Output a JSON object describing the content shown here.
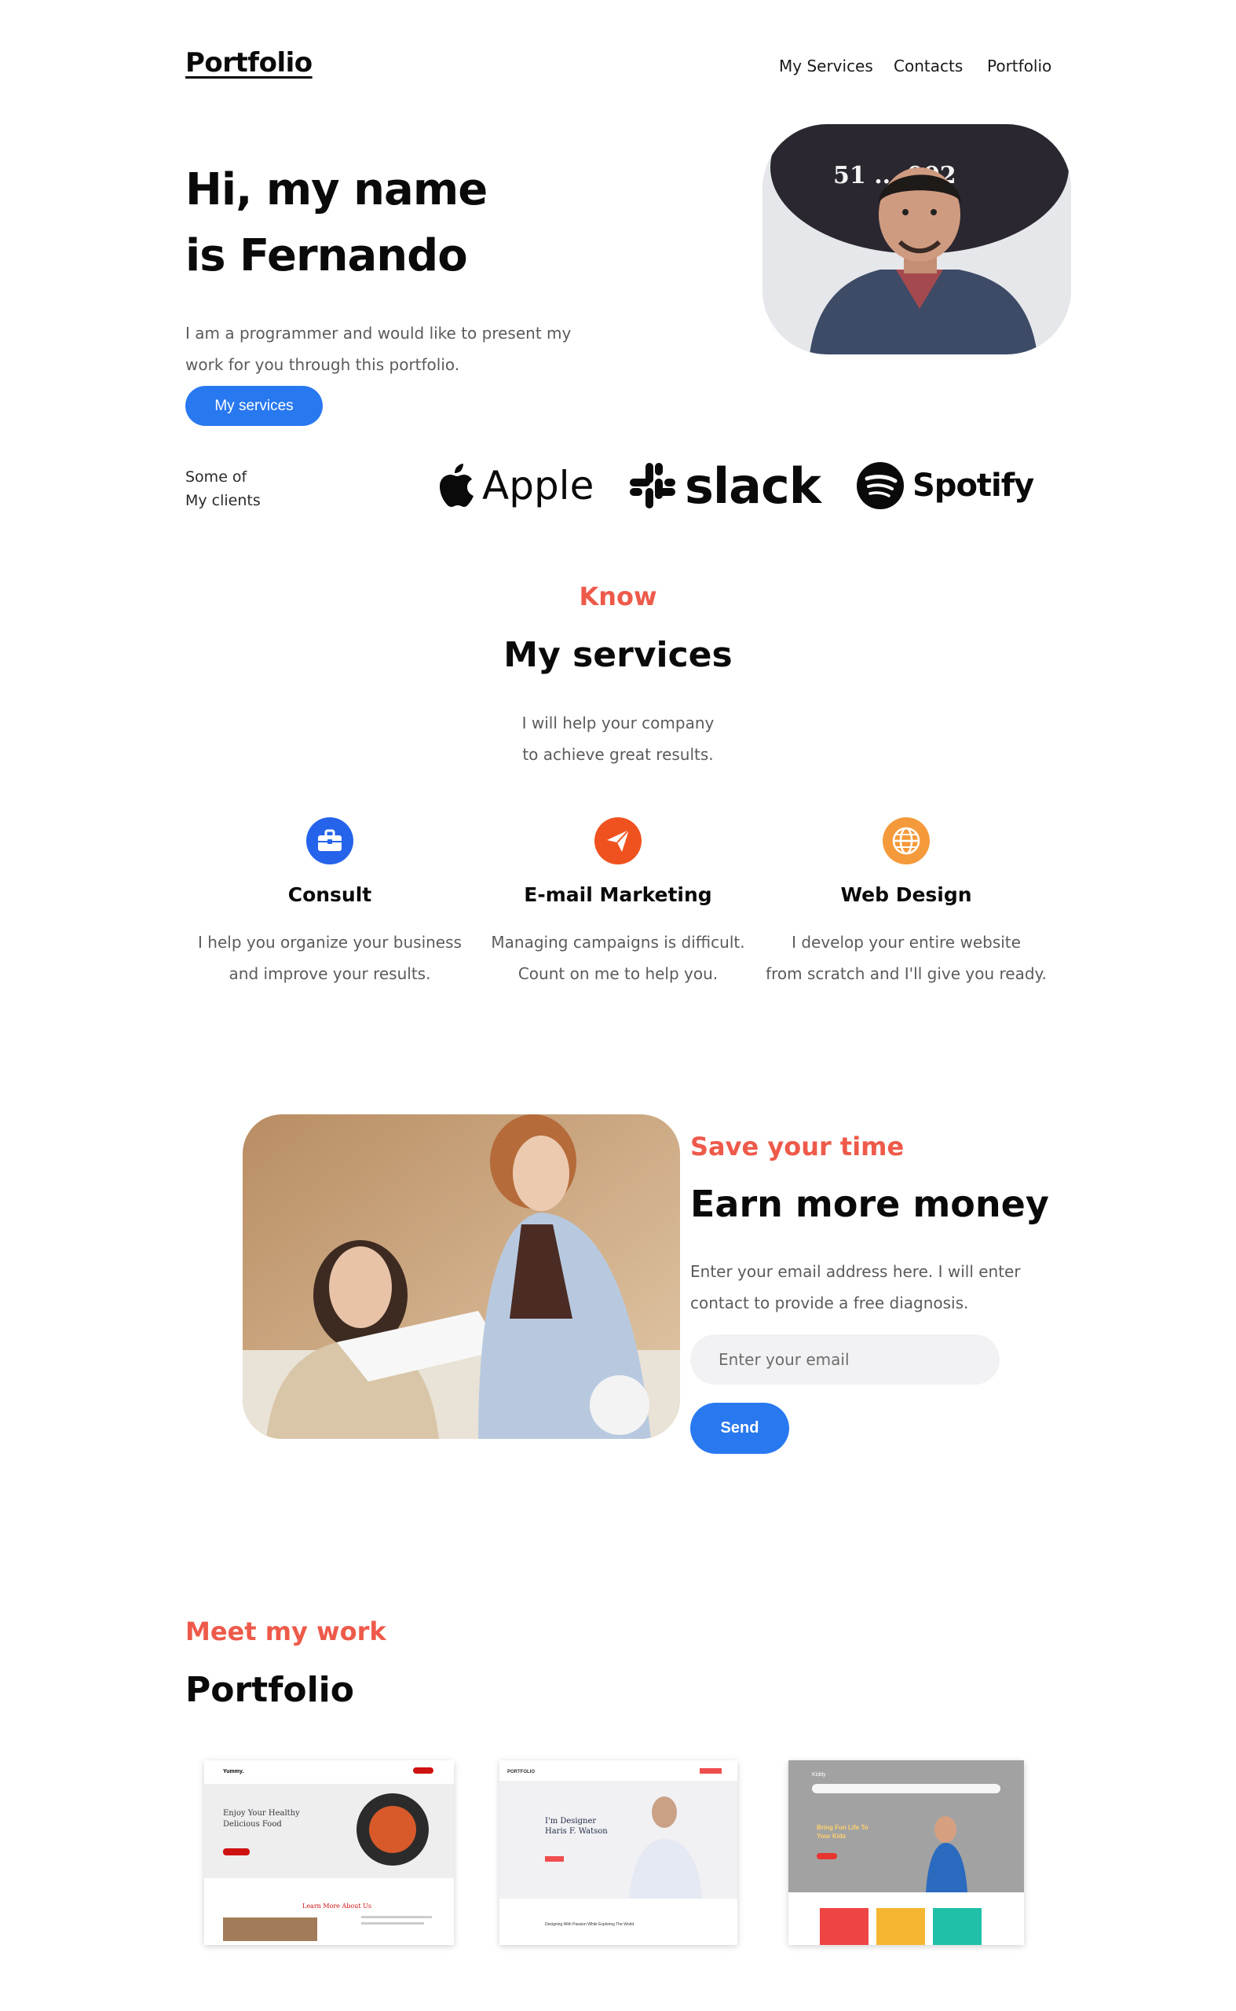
{
  "header": {
    "logo": "Portfolio",
    "nav": [
      "My Services",
      "Contacts",
      "Portfolio"
    ]
  },
  "hero": {
    "title_line1": "Hi, my name",
    "title_line2": "is Fernando",
    "text_line1": "I am a programmer and would like to present my",
    "text_line2": "work for you through this portfolio.",
    "button": "My services",
    "photo_sign": "51 ... 002"
  },
  "clients": {
    "label_line1": "Some of",
    "label_line2": "My clients",
    "names": [
      "Apple",
      "slack",
      "Spotify"
    ]
  },
  "services": {
    "eyebrow": "Know",
    "title": "My services",
    "sub_line1": "I will help your company",
    "sub_line2": "to achieve great results.",
    "items": [
      {
        "name": "Consult",
        "icon": "briefcase-icon",
        "color": "#2563eb",
        "desc_line1": "I help you organize your business",
        "desc_line2": "and improve your results."
      },
      {
        "name": "E-mail Marketing",
        "icon": "paper-plane-icon",
        "color": "#f0521f",
        "desc_line1": "Managing campaigns is difficult.",
        "desc_line2": "Count on me to help you."
      },
      {
        "name": "Web Design",
        "icon": "globe-icon",
        "color": "#f59a3b",
        "desc_line1": "I develop your entire website",
        "desc_line2": "from scratch and I'll give you ready."
      }
    ]
  },
  "save": {
    "eyebrow": "Save your time",
    "title": "Earn more money",
    "text_line1": "Enter your email address here. I will enter",
    "text_line2": "contact to provide a free diagnosis.",
    "placeholder": "Enter your email",
    "button": "Send"
  },
  "work": {
    "eyebrow": "Meet my work",
    "title": "Portfolio",
    "thumbs": [
      {
        "brand": "Yummy.",
        "headline_line1": "Enjoy Your Healthy",
        "headline_line2": "Delicious Food",
        "footer": "Learn More About Us"
      },
      {
        "brand": "PORTFOLIO",
        "headline_line1": "I'm Designer",
        "headline_line2": "Haris F. Watson",
        "footer": "Designing With Passion While Exploring The World"
      },
      {
        "brand": "Kiddy",
        "headline_line1": "Bring Fun Life To",
        "headline_line2": "Your Kids"
      }
    ]
  },
  "colors": {
    "accent": "#ee5a4a",
    "primary": "#2878f0"
  }
}
